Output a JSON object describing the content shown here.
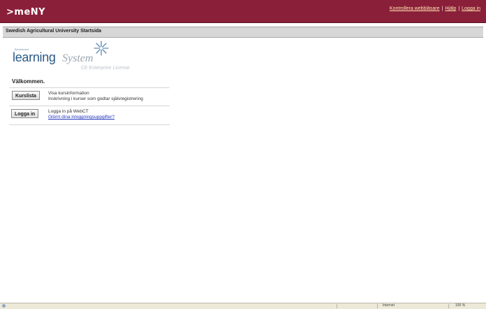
{
  "header": {
    "logo": ">meNY",
    "links": [
      {
        "label": "Kontrollera webbläsare"
      },
      {
        "label": "Hjälp"
      },
      {
        "label": "Logga in"
      }
    ],
    "separator": "|"
  },
  "breadcrumb": {
    "title": "Swedish Agricultural University Startsida"
  },
  "brand": {
    "small_text": "Blackboard",
    "learning": "learning",
    "system": "System",
    "license": "CE Enterprise License"
  },
  "welcome": "Välkommen.",
  "rows": [
    {
      "button": "Kurslista",
      "line1": "Visa kursinformation",
      "line2": "Inskrivning i kurser som godtar självregistrering"
    },
    {
      "button": "Logga in",
      "line1": "Logga in på WebCT",
      "link": "Glömt dina inloggningsuppgifter?"
    }
  ],
  "statusbar": {
    "zone": "Internet",
    "zoom": "100 %"
  },
  "colors": {
    "header_bg": "#8a1f3a",
    "link": "#2233bb",
    "brand_blue": "#2c5a86"
  }
}
